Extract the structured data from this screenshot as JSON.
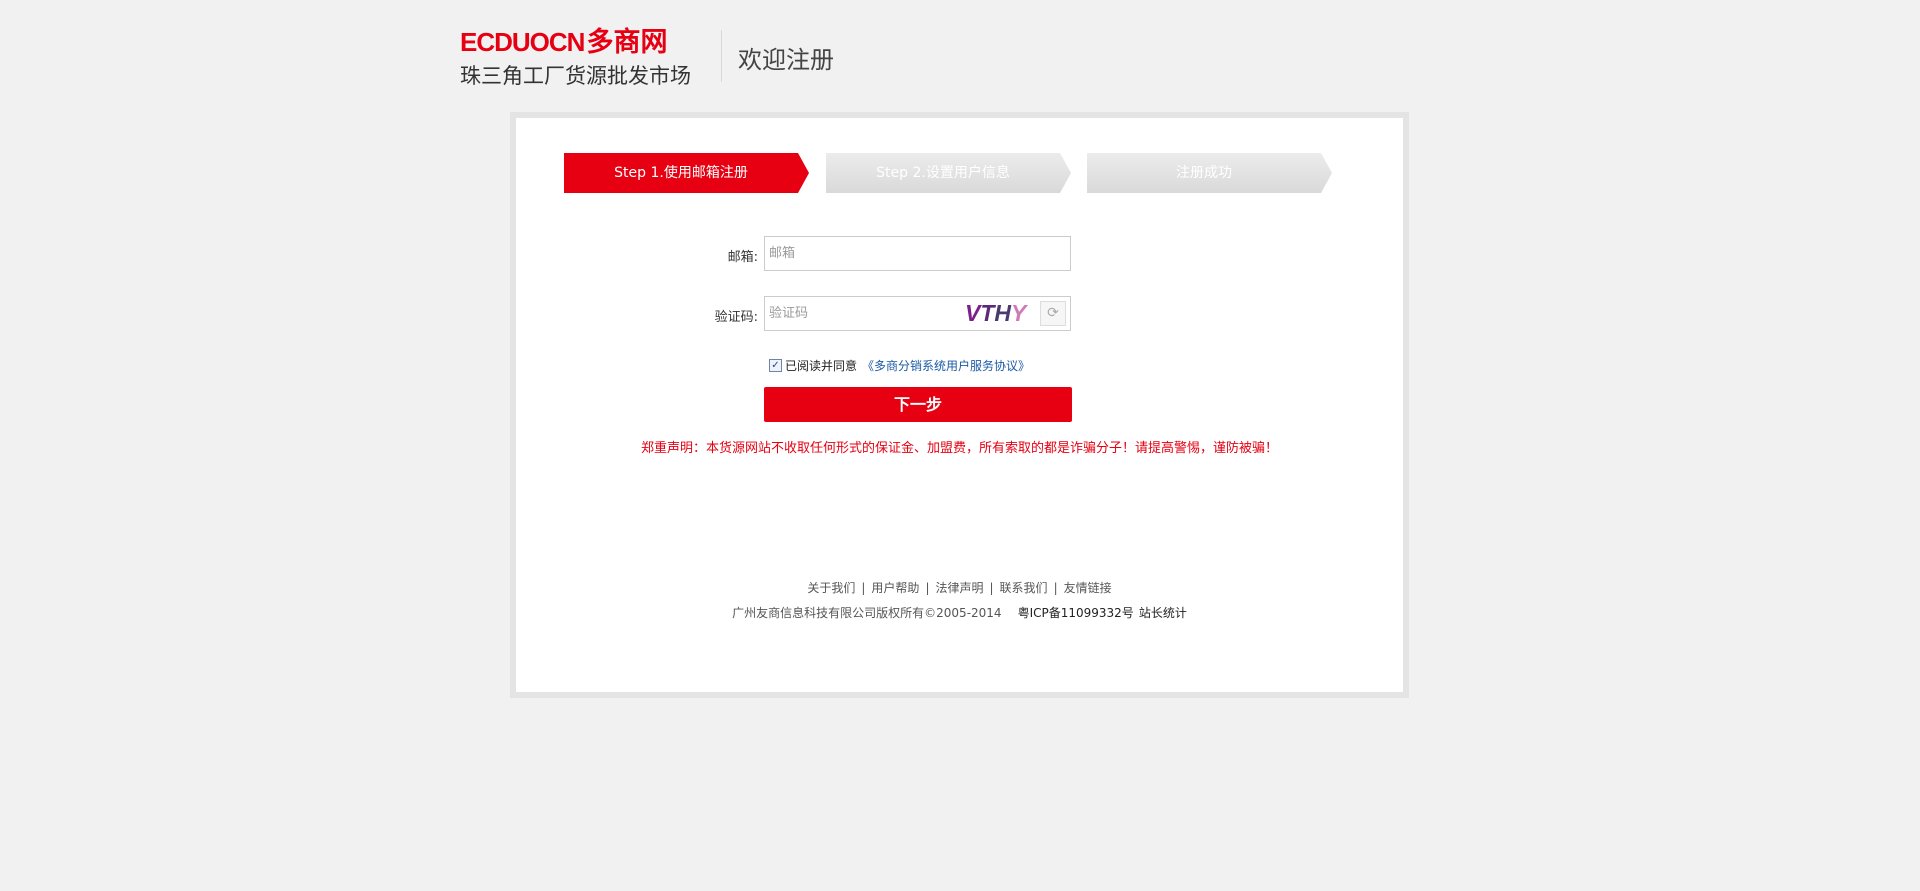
{
  "header": {
    "logo_en": "ECDUOCN",
    "logo_cn": "多商网",
    "logo_sub": "珠三角工厂货源批发市场",
    "title": "欢迎注册"
  },
  "steps": [
    {
      "label": "Step 1.使用邮箱注册",
      "state": "active"
    },
    {
      "label": "Step 2.设置用户信息",
      "state": "inactive"
    },
    {
      "label": "注册成功",
      "state": "inactive"
    }
  ],
  "form": {
    "email_label": "邮箱:",
    "email_placeholder": "邮箱",
    "captcha_label": "验证码:",
    "captcha_placeholder": "验证码",
    "captcha_chars": [
      "V",
      "T",
      "H",
      "Y"
    ],
    "agree_checked": true,
    "agree_text": "已阅读并同意",
    "agreement_link": "《多商分销系统用户服务协议》",
    "next_button": "下一步"
  },
  "notice": "郑重声明：本货源网站不收取任何形式的保证金、加盟费，所有索取的都是诈骗分子！请提高警惕，谨防被骗！",
  "footer": {
    "links": [
      "关于我们",
      "用户帮助",
      "法律声明",
      "联系我们",
      "友情链接"
    ],
    "separator": "|",
    "copyright": "广州友商信息科技有限公司版权所有©2005-2014",
    "icp": "粤ICP备11099332号",
    "stats": "站长统计"
  },
  "colors": {
    "brand_red": "#e60012",
    "background": "#f1f1f1",
    "link_blue": "#1a5aa6",
    "step_inactive": "#dcdcdc"
  },
  "icons": {
    "refresh": "refresh-icon",
    "checkbox": "checkbox-checked-icon"
  }
}
